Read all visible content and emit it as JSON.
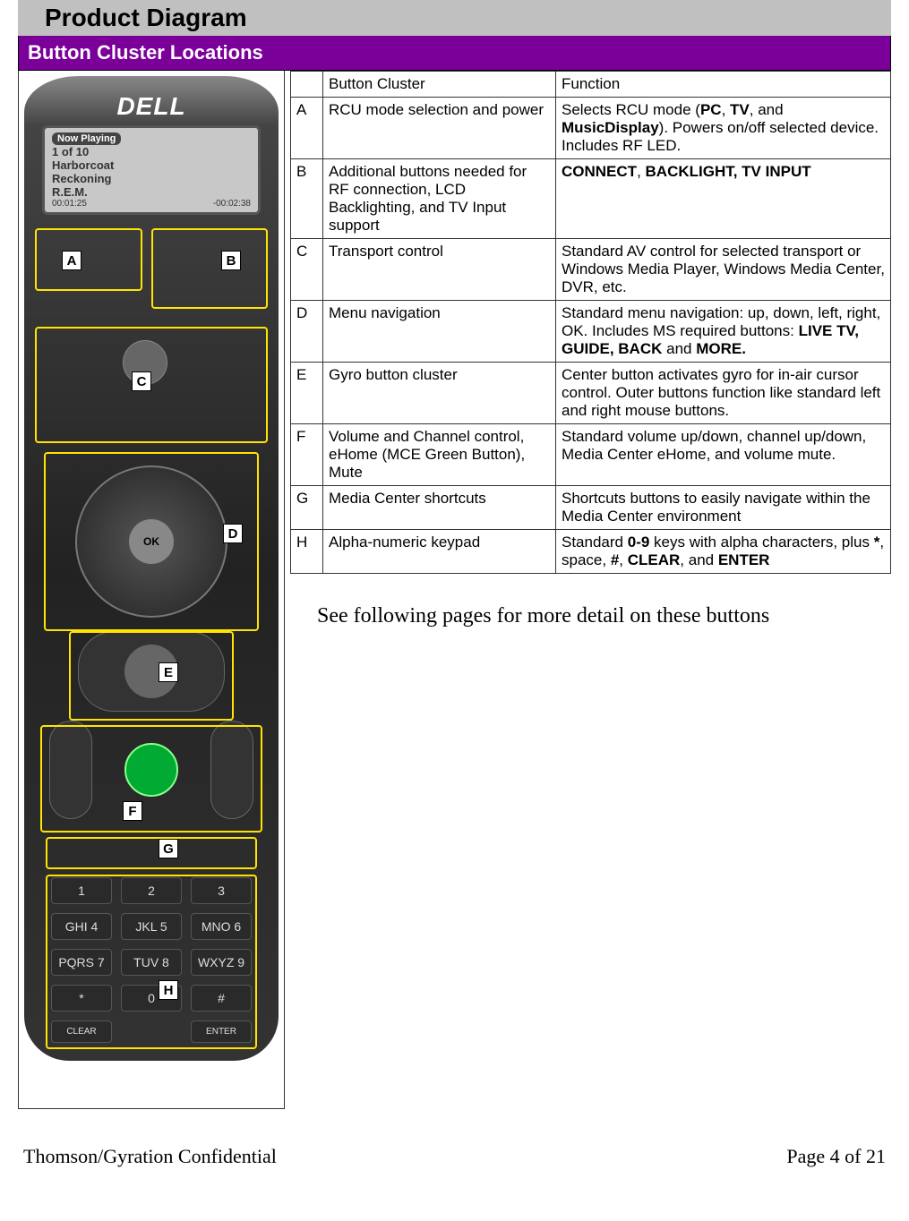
{
  "page": {
    "title": "Product Diagram",
    "section_title": "Button Cluster Locations",
    "follow_note": "See following pages for more detail on these buttons"
  },
  "remote": {
    "brand": "DELL",
    "lcd": {
      "header": "Now Playing",
      "line1": "1 of 10",
      "line2": "Harborcoat",
      "line3": "Reckoning",
      "line4": "R.E.M.",
      "time_left": "00:01:25",
      "time_right": "-00:02:38"
    },
    "labels": [
      "A",
      "B",
      "C",
      "D",
      "E",
      "F",
      "G",
      "H"
    ],
    "keypad_labels": [
      "1",
      "2",
      "3",
      "GHI 4",
      "JKL 5",
      "MNO 6",
      "PQRS 7",
      "TUV 8",
      "WXYZ 9",
      "*",
      "0",
      "#",
      "CLEAR",
      "",
      "ENTER"
    ]
  },
  "table": {
    "header": {
      "col1": "",
      "col2": "Button Cluster",
      "col3": "Function"
    },
    "rows": [
      {
        "id": "A",
        "cluster": "RCU mode selection and power",
        "function_pre": "Selects RCU mode (",
        "pc": "PC",
        "sep1": ", ",
        "tv": "TV",
        "sep2": ", and ",
        "md": "MusicDisplay",
        "function_post": "). Powers on/off selected device. Includes RF LED."
      },
      {
        "id": "B",
        "cluster": "Additional buttons needed for RF connection, LCD Backlighting, and TV Input support",
        "connect": "CONNECT",
        "sep": ", ",
        "rest": "BACKLIGHT, TV INPUT"
      },
      {
        "id": "C",
        "cluster": "Transport control",
        "function": "Standard AV control for selected transport or Windows Media Player, Windows Media Center, DVR, etc."
      },
      {
        "id": "D",
        "cluster": "Menu navigation",
        "function_pre": "Standard menu navigation: up, down, left, right, OK. Includes MS required buttons: ",
        "b1": "LIVE TV, GUIDE, BACK",
        "mid": " and ",
        "b2": "MORE."
      },
      {
        "id": "E",
        "cluster": "Gyro button cluster",
        "function": "Center button activates gyro for in-air cursor control. Outer buttons function like standard left and right mouse buttons."
      },
      {
        "id": "F",
        "cluster": "Volume and Channel control, eHome (MCE Green Button), Mute",
        "function": "Standard volume up/down, channel up/down, Media Center eHome, and volume mute."
      },
      {
        "id": "G",
        "cluster": "Media Center shortcuts",
        "function": "Shortcuts buttons to easily navigate within the Media Center environment"
      },
      {
        "id": "H",
        "cluster": "Alpha-numeric keypad",
        "function_pre": "Standard ",
        "k09": "0-9",
        "mid1": " keys with alpha characters, plus ",
        "star": "*",
        "mid2": ", space, ",
        "hash": "#",
        "mid3": ", ",
        "clear": "CLEAR",
        "mid4": ", and ",
        "enter": "ENTER"
      }
    ]
  },
  "footer": {
    "left": "Thomson/Gyration Confidential",
    "right": "Page 4 of 21"
  }
}
